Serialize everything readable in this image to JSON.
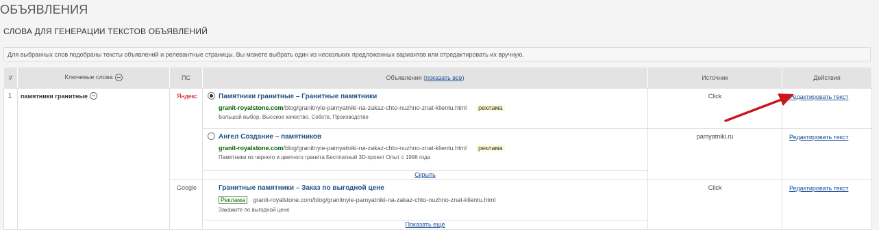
{
  "page": {
    "title": "ОБЪЯВЛЕНИЯ",
    "section_title": "СЛОВА ДЛЯ ГЕНЕРАЦИИ ТЕКСТОВ ОБЪЯВЛЕНИЙ",
    "info": "Для выбранных слов подобраны тексты объявлений и релевантные страницы. Вы можете выбрать один из нескольких предложенных вариантов или отредактировать их вручную."
  },
  "table": {
    "headers": {
      "num": "#",
      "keywords": "Ключевые слова",
      "ps": "ПС",
      "ads": "Объявления",
      "ads_link": "показать все",
      "source": "Источник",
      "actions": "Действия"
    },
    "row": {
      "num": "1",
      "keyword": "памятники гранитные",
      "yandex": {
        "ps_label": "Яндекс",
        "ads": [
          {
            "title": "Памятники гранитные – Гранитные памятники",
            "domain": "granit-royalstone.com",
            "path": "/blog/granitnyie-pamyatniki-na-zakaz-chto-nuzhno-znat-klientu.html",
            "tag": "реклама",
            "desc": "Большой выбор. Высокое качество. Собств. Производство",
            "selected": true,
            "source": "Click",
            "action": "Редактировать текст"
          },
          {
            "title": "Ангел Создание – памятников",
            "domain": "granit-royalstone.com",
            "path": "/blog/granitnyie-pamyatniki-na-zakaz-chto-nuzhno-znat-klientu.html",
            "tag": "реклама",
            "desc": "Памятники из черного и цветного гранита Бесплатный 3D-проект Опыт с 1996 года",
            "selected": false,
            "source": "pamyatniki.ru",
            "action": "Редактировать текст"
          }
        ],
        "hide_link": "Скрыть"
      },
      "google": {
        "ps_label": "Google",
        "ad": {
          "title": "Гранитные памятники – Заказ по выгодной цене",
          "tag": "Реклама",
          "url": "granit-royalstone.com/blog/granitnyie-pamyatniki-na-zakaz-chto-nuzhno-znat-klientu.html",
          "desc": "Закажите по выгодной цене",
          "source": "Click",
          "action": "Редактировать текст"
        },
        "more_link": "Показать еще"
      }
    }
  },
  "colors": {
    "arrow": "#c8161d",
    "link": "#1a4f9c",
    "url_green": "#006000",
    "header_bg": "#e3e3e3"
  }
}
